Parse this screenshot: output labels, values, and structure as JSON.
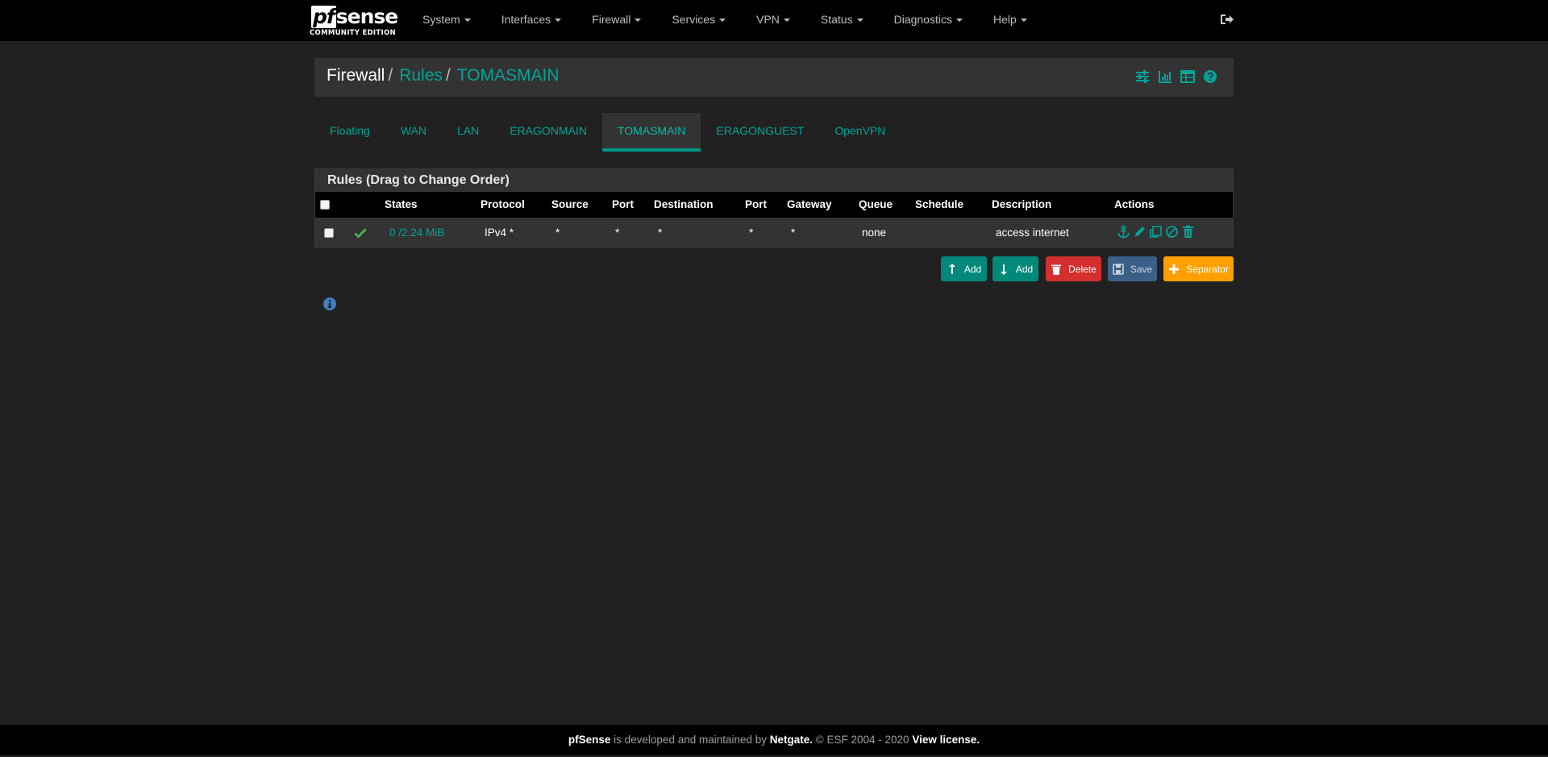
{
  "brand": {
    "name_pf": "pf",
    "name_sense": "sense",
    "edition": "COMMUNITY EDITION"
  },
  "menu": [
    {
      "label": "System"
    },
    {
      "label": "Interfaces"
    },
    {
      "label": "Firewall"
    },
    {
      "label": "Services"
    },
    {
      "label": "VPN"
    },
    {
      "label": "Status"
    },
    {
      "label": "Diagnostics"
    },
    {
      "label": "Help"
    }
  ],
  "breadcrumb": {
    "root": "Firewall",
    "section": "Rules",
    "current": "TOMASMAIN",
    "sep": "/"
  },
  "tabs": [
    {
      "label": "Floating"
    },
    {
      "label": "WAN"
    },
    {
      "label": "LAN"
    },
    {
      "label": "ERAGONMAIN"
    },
    {
      "label": "TOMASMAIN",
      "active": true
    },
    {
      "label": "ERAGONGUEST"
    },
    {
      "label": "OpenVPN"
    }
  ],
  "panel": {
    "title": "Rules (Drag to Change Order)"
  },
  "table": {
    "headers": [
      "States",
      "Protocol",
      "Source",
      "Port",
      "Destination",
      "Port",
      "Gateway",
      "Queue",
      "Schedule",
      "Description",
      "Actions"
    ],
    "rows": [
      {
        "states": "0 /2.24 MiB",
        "protocol": "IPv4 *",
        "source": "*",
        "src_port": "*",
        "destination": "*",
        "dst_port": "*",
        "gateway": "*",
        "queue": "none",
        "schedule": "",
        "description": "access internet"
      }
    ]
  },
  "buttons": {
    "add_top": "Add",
    "add_bottom": "Add",
    "delete": "Delete",
    "save": "Save",
    "separator": "Separator"
  },
  "footer": {
    "product": "pfSense",
    "text1": " is developed and maintained by ",
    "company": "Netgate.",
    "text2": " © ESF 2004 - 2020 ",
    "license": "View license."
  },
  "colors": {
    "accent": "#00a497",
    "pass": "#4caf50",
    "navbar": "#000000",
    "panel": "#333333"
  }
}
